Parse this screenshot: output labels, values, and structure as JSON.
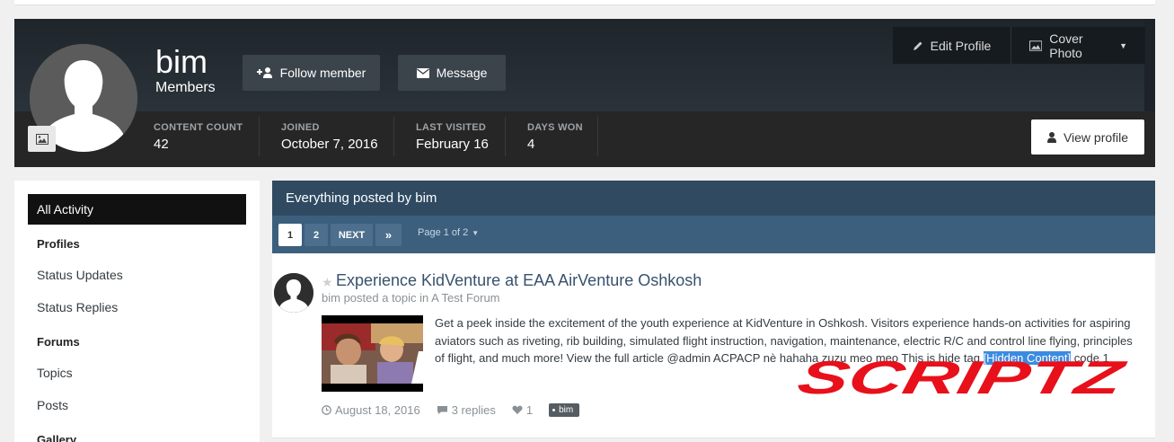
{
  "profile": {
    "username": "bim",
    "group": "Members",
    "follow_label": "Follow member",
    "message_label": "Message",
    "edit_profile_label": "Edit Profile",
    "cover_photo_label": "Cover Photo",
    "view_profile_label": "View profile",
    "stats": [
      {
        "label": "CONTENT COUNT",
        "value": "42"
      },
      {
        "label": "JOINED",
        "value": "October 7, 2016"
      },
      {
        "label": "LAST VISITED",
        "value": "February 16"
      },
      {
        "label": "DAYS WON",
        "value": "4"
      }
    ]
  },
  "sidebar": {
    "active": "All Activity",
    "groups": [
      {
        "title": "Profiles",
        "items": [
          "Status Updates",
          "Status Replies"
        ]
      },
      {
        "title": "Forums",
        "items": [
          "Topics",
          "Posts"
        ]
      },
      {
        "title": "Gallery",
        "items": []
      }
    ]
  },
  "main": {
    "title": "Everything posted by bim",
    "pagination": {
      "pages": [
        "1",
        "2"
      ],
      "next_label": "NEXT",
      "last_label": "»",
      "info": "Page 1 of 2"
    },
    "post": {
      "title": "Experience KidVenture at EAA AirVenture Oshkosh",
      "author": "bim",
      "action": "posted a topic in",
      "forum": "A Test Forum",
      "text_1": "Get a peek inside the excitement of the youth experience at KidVenture in Oshkosh. Visitors experience hands-on activities for aspiring aviators such as riveting, rib building, simulated flight instruction, navigation, maintenance, electric R/C and control line flying, principles",
      "text_2_before": "of flight, and much more! View the full article @admin ACPACP nè hahaha zuzu meo meo This is hide tag ",
      "hidden_label": "[Hidden Content]",
      "text_2_after": " code 1",
      "date": "August 18, 2016",
      "replies": "3 replies",
      "likes": "1",
      "tag": "bim"
    }
  },
  "watermark": "SCRIPTZ",
  "colors": {
    "header_bg": "#222222",
    "title_bar": "#2f4a61",
    "pager_bar": "#3d5f7e",
    "link": "#37526d",
    "watermark": "#e8101a"
  }
}
